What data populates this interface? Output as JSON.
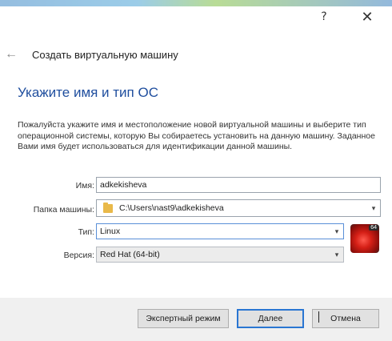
{
  "titlebar": {
    "help": "?",
    "close": "✕"
  },
  "nav": {
    "back_icon": "←",
    "title": "Создать виртуальную машину"
  },
  "heading": "Укажите имя и тип ОС",
  "description": "Пожалуйста укажите имя и местоположение новой виртуальной машины и выберите тип операционной системы, которую Вы собираетесь установить на данную машину. Заданное Вами имя будет использоваться для идентификации данной машины.",
  "form": {
    "name_label": "Имя:",
    "name_value": "adkekisheva",
    "folder_label": "Папка машины:",
    "folder_value": "C:\\Users\\nast9\\adkekisheva",
    "type_label": "Тип:",
    "type_value": "Linux",
    "version_label": "Версия:",
    "version_value": "Red Hat (64-bit)",
    "os_badge": "64"
  },
  "buttons": {
    "expert": "Экспертный режим",
    "next": "Далее",
    "cancel": "Отмена"
  }
}
